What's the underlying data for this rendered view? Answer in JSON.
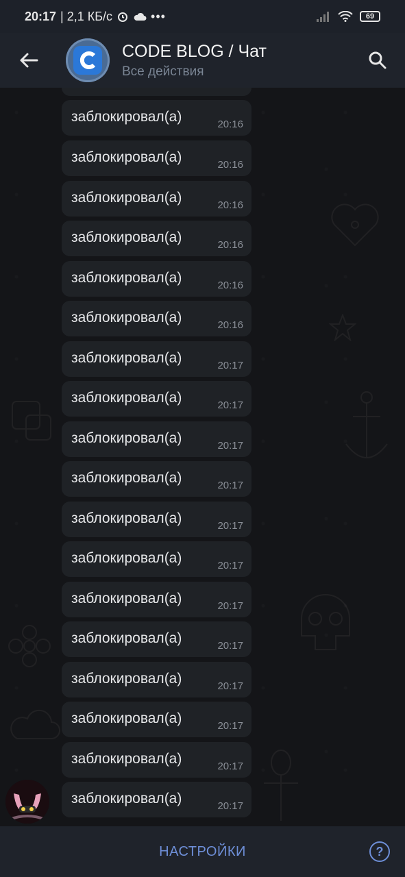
{
  "status_bar": {
    "time": "20:17",
    "speed": "| 2,1 КБ/с",
    "battery": "69"
  },
  "header": {
    "title": "CODE BLOG / Чат",
    "subtitle": "Все действия"
  },
  "messages": [
    {
      "text": "заблокировал(а)",
      "time": "20:16"
    },
    {
      "text": "заблокировал(а)",
      "time": "20:16"
    },
    {
      "text": "заблокировал(а)",
      "time": "20:16"
    },
    {
      "text": "заблокировал(а)",
      "time": "20:16"
    },
    {
      "text": "заблокировал(а)",
      "time": "20:16"
    },
    {
      "text": "заблокировал(а)",
      "time": "20:16"
    },
    {
      "text": "заблокировал(а)",
      "time": "20:17"
    },
    {
      "text": "заблокировал(а)",
      "time": "20:17"
    },
    {
      "text": "заблокировал(а)",
      "time": "20:17"
    },
    {
      "text": "заблокировал(а)",
      "time": "20:17"
    },
    {
      "text": "заблокировал(а)",
      "time": "20:17"
    },
    {
      "text": "заблокировал(а)",
      "time": "20:17"
    },
    {
      "text": "заблокировал(а)",
      "time": "20:17"
    },
    {
      "text": "заблокировал(а)",
      "time": "20:17"
    },
    {
      "text": "заблокировал(а)",
      "time": "20:17"
    },
    {
      "text": "заблокировал(а)",
      "time": "20:17"
    },
    {
      "text": "заблокировал(а)",
      "time": "20:17"
    },
    {
      "text": "заблокировал(а)",
      "time": "20:17"
    }
  ],
  "bottom_bar": {
    "settings_label": "НАСТРОЙКИ",
    "help_label": "?"
  },
  "colors": {
    "accent": "#6e8fd8",
    "bubble": "#1f2226",
    "header": "#1f232b"
  }
}
